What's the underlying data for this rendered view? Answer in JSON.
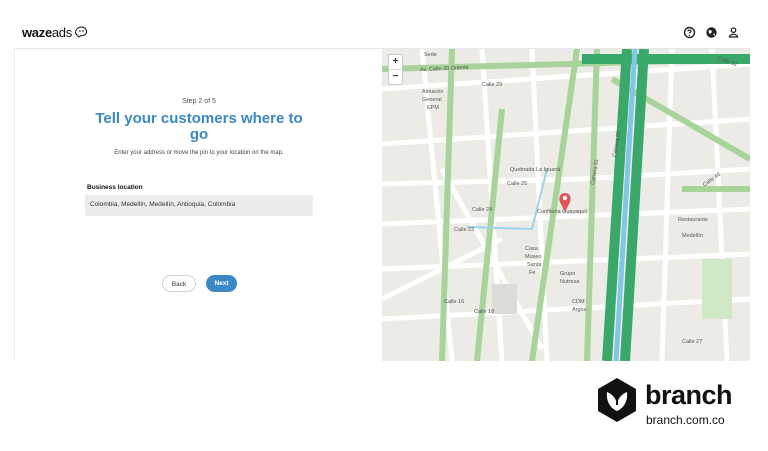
{
  "app": {
    "logo_bold": "waze",
    "logo_light": "ads"
  },
  "header": {
    "icons": [
      "help-icon",
      "globe-icon",
      "account-icon"
    ]
  },
  "form": {
    "step": "Step 2 of 5",
    "title": "Tell your customers where to go",
    "subtitle": "Enter your address or move the pin to your location on the map.",
    "field_label": "Business location",
    "field_value": "Colombia, Medellín, Medellín, Antioquia, Colombia",
    "back_label": "Back",
    "next_label": "Next"
  },
  "map": {
    "zoom_in": "+",
    "zoom_out": "−",
    "labels": [
      "Av. Calle 30 Oriente",
      "Almacén",
      "General",
      "EPM",
      "Calle 25",
      "Calle 24",
      "Calle 23",
      "Confiteria Guayaquil",
      "Casa",
      "Museo",
      "Santa",
      "Fe",
      "Grupo",
      "Nutresa",
      "CDM",
      "Argos",
      "Calle 16",
      "Calle 18",
      "Carrera 51",
      "Carrera 50",
      "Calle 46",
      "Restaurante",
      "Medellín",
      "Calle 32",
      "Quebrada La Iguaná",
      "Sede",
      "Calle 29",
      "Calle 27"
    ],
    "pin_color": "#e0545a",
    "accent_color": "#3b88c6"
  },
  "brand": {
    "name": "branch",
    "url": "branch.com.co"
  }
}
